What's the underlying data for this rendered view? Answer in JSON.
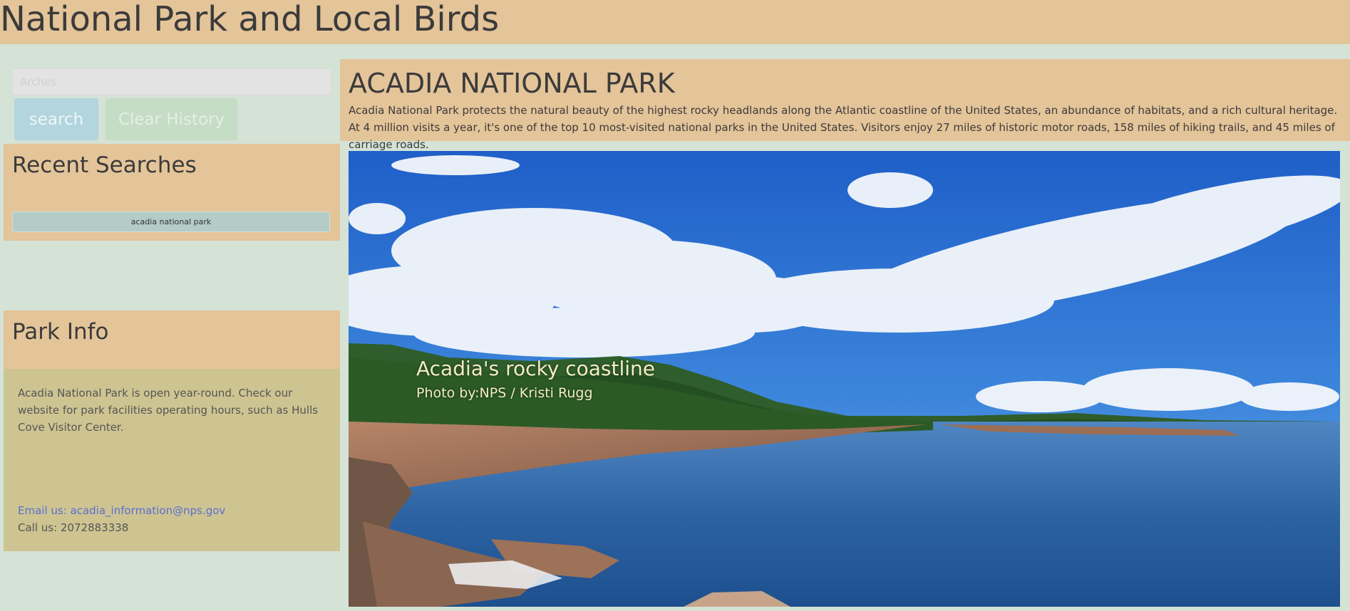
{
  "header": {
    "title": "National Park and Local Birds"
  },
  "search": {
    "placeholder": "Arches",
    "search_label": "search",
    "clear_label": "Clear History"
  },
  "recent": {
    "title": "Recent Searches",
    "items": [
      {
        "label": "acadia national park"
      }
    ]
  },
  "park_info": {
    "title": "Park Info",
    "text": "Acadia National Park is open year-round. Check our website for park facilities operating hours, such as Hulls Cove Visitor Center.",
    "email": "Email us: acadia_information@nps.gov",
    "phone": "Call us: 2072883338"
  },
  "park": {
    "name": "ACADIA NATIONAL PARK",
    "description": "Acadia National Park protects the natural beauty of the highest rocky headlands along the Atlantic coastline of the United States, an abundance of habitats, and a rich cultural heritage. At 4 million visits a year, it's one of the top 10 most-visited national parks in the United States. Visitors enjoy 27 miles of historic motor roads, 158 miles of hiking trails, and 45 miles of carriage roads.",
    "image": {
      "caption": "Acadia's rocky coastline",
      "credit": "Photo by:NPS / Kristi Rugg"
    }
  },
  "colors": {
    "background": "#d5e2d6",
    "header": "#e4c499",
    "card": "#e4c499",
    "info_body": "#cec491",
    "search_button": "#b2d5de",
    "clear_button": "#c5dcc5",
    "recent_item": "#b3ccc6",
    "link": "#5a6fd1"
  }
}
